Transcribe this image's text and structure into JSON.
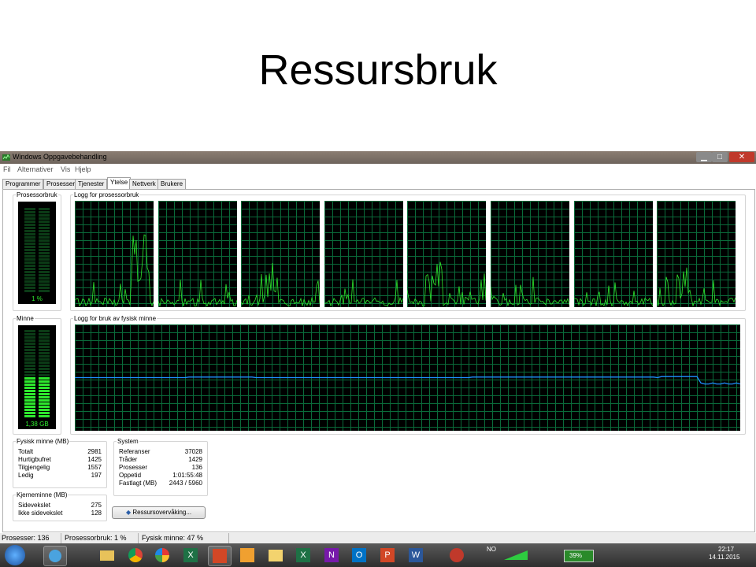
{
  "slide": {
    "title": "Ressursbruk"
  },
  "window": {
    "title": "Windows Oppgavebehandling",
    "controls": {
      "minimize": "▁",
      "maximize": "□",
      "close": "✕"
    }
  },
  "menu": [
    "Fil",
    "Alternativer",
    "Vis",
    "Hjelp"
  ],
  "tabs": [
    "Programmer",
    "Prosesser",
    "Tjenester",
    "Ytelse",
    "Nettverk",
    "Brukere"
  ],
  "active_tab": "Ytelse",
  "cpu": {
    "usage_label": "Prosessorbruk",
    "usage_value": "1 %",
    "usage_fraction": 0.01,
    "history_label": "Logg for prosessorbruk",
    "core_count_shown": 8
  },
  "memory": {
    "usage_label": "Minne",
    "usage_value": "1,38 GB",
    "usage_fraction": 0.47,
    "history_label": "Logg for bruk av fysisk minne"
  },
  "physical_memory": {
    "label": "Fysisk minne (MB)",
    "rows": [
      {
        "k": "Totalt",
        "v": "2981"
      },
      {
        "k": "Hurtigbufret",
        "v": "1425"
      },
      {
        "k": "Tilgjengelig",
        "v": "1557"
      },
      {
        "k": "Ledig",
        "v": "197"
      }
    ]
  },
  "kernel_memory": {
    "label": "Kjerneminne (MB)",
    "rows": [
      {
        "k": "Sidevekslet",
        "v": "275"
      },
      {
        "k": "Ikke sidevekslet",
        "v": "128"
      }
    ]
  },
  "system": {
    "label": "System",
    "rows": [
      {
        "k": "Referanser",
        "v": "37028"
      },
      {
        "k": "Tråder",
        "v": "1429"
      },
      {
        "k": "Prosesser",
        "v": "136"
      },
      {
        "k": "Oppetid",
        "v": "1:01:55:48"
      },
      {
        "k": "Fastlagt (MB)",
        "v": "2443 / 5960"
      }
    ]
  },
  "resource_monitor_button": "Ressursovervåking...",
  "statusbar": {
    "processes": "Prosesser: 136",
    "cpu": "Prosessorbruk: 1 %",
    "memory": "Fysisk minne: 47 %"
  },
  "taskbar": {
    "apps": [
      "start-orb-icon",
      "network-app-icon",
      "file-explorer-icon",
      "chrome-icon",
      "picasa-icon",
      "excel-icon",
      "powerpoint-viewer-icon",
      "start-screen-icon",
      "folder-icon",
      "excel-icon",
      "onenote-icon",
      "outlook-icon",
      "powerpoint-icon",
      "word-icon",
      "crossover-icon"
    ],
    "language": "NO",
    "battery": "39%",
    "time": "22:17",
    "date": "14.11.2015"
  },
  "colors": {
    "graph_bg": "#000000",
    "grid": "#0a6b3a",
    "cpu_trace": "#2ee82e",
    "memory_trace": "#1e90ff",
    "meter_fill": "#2ee82e"
  }
}
